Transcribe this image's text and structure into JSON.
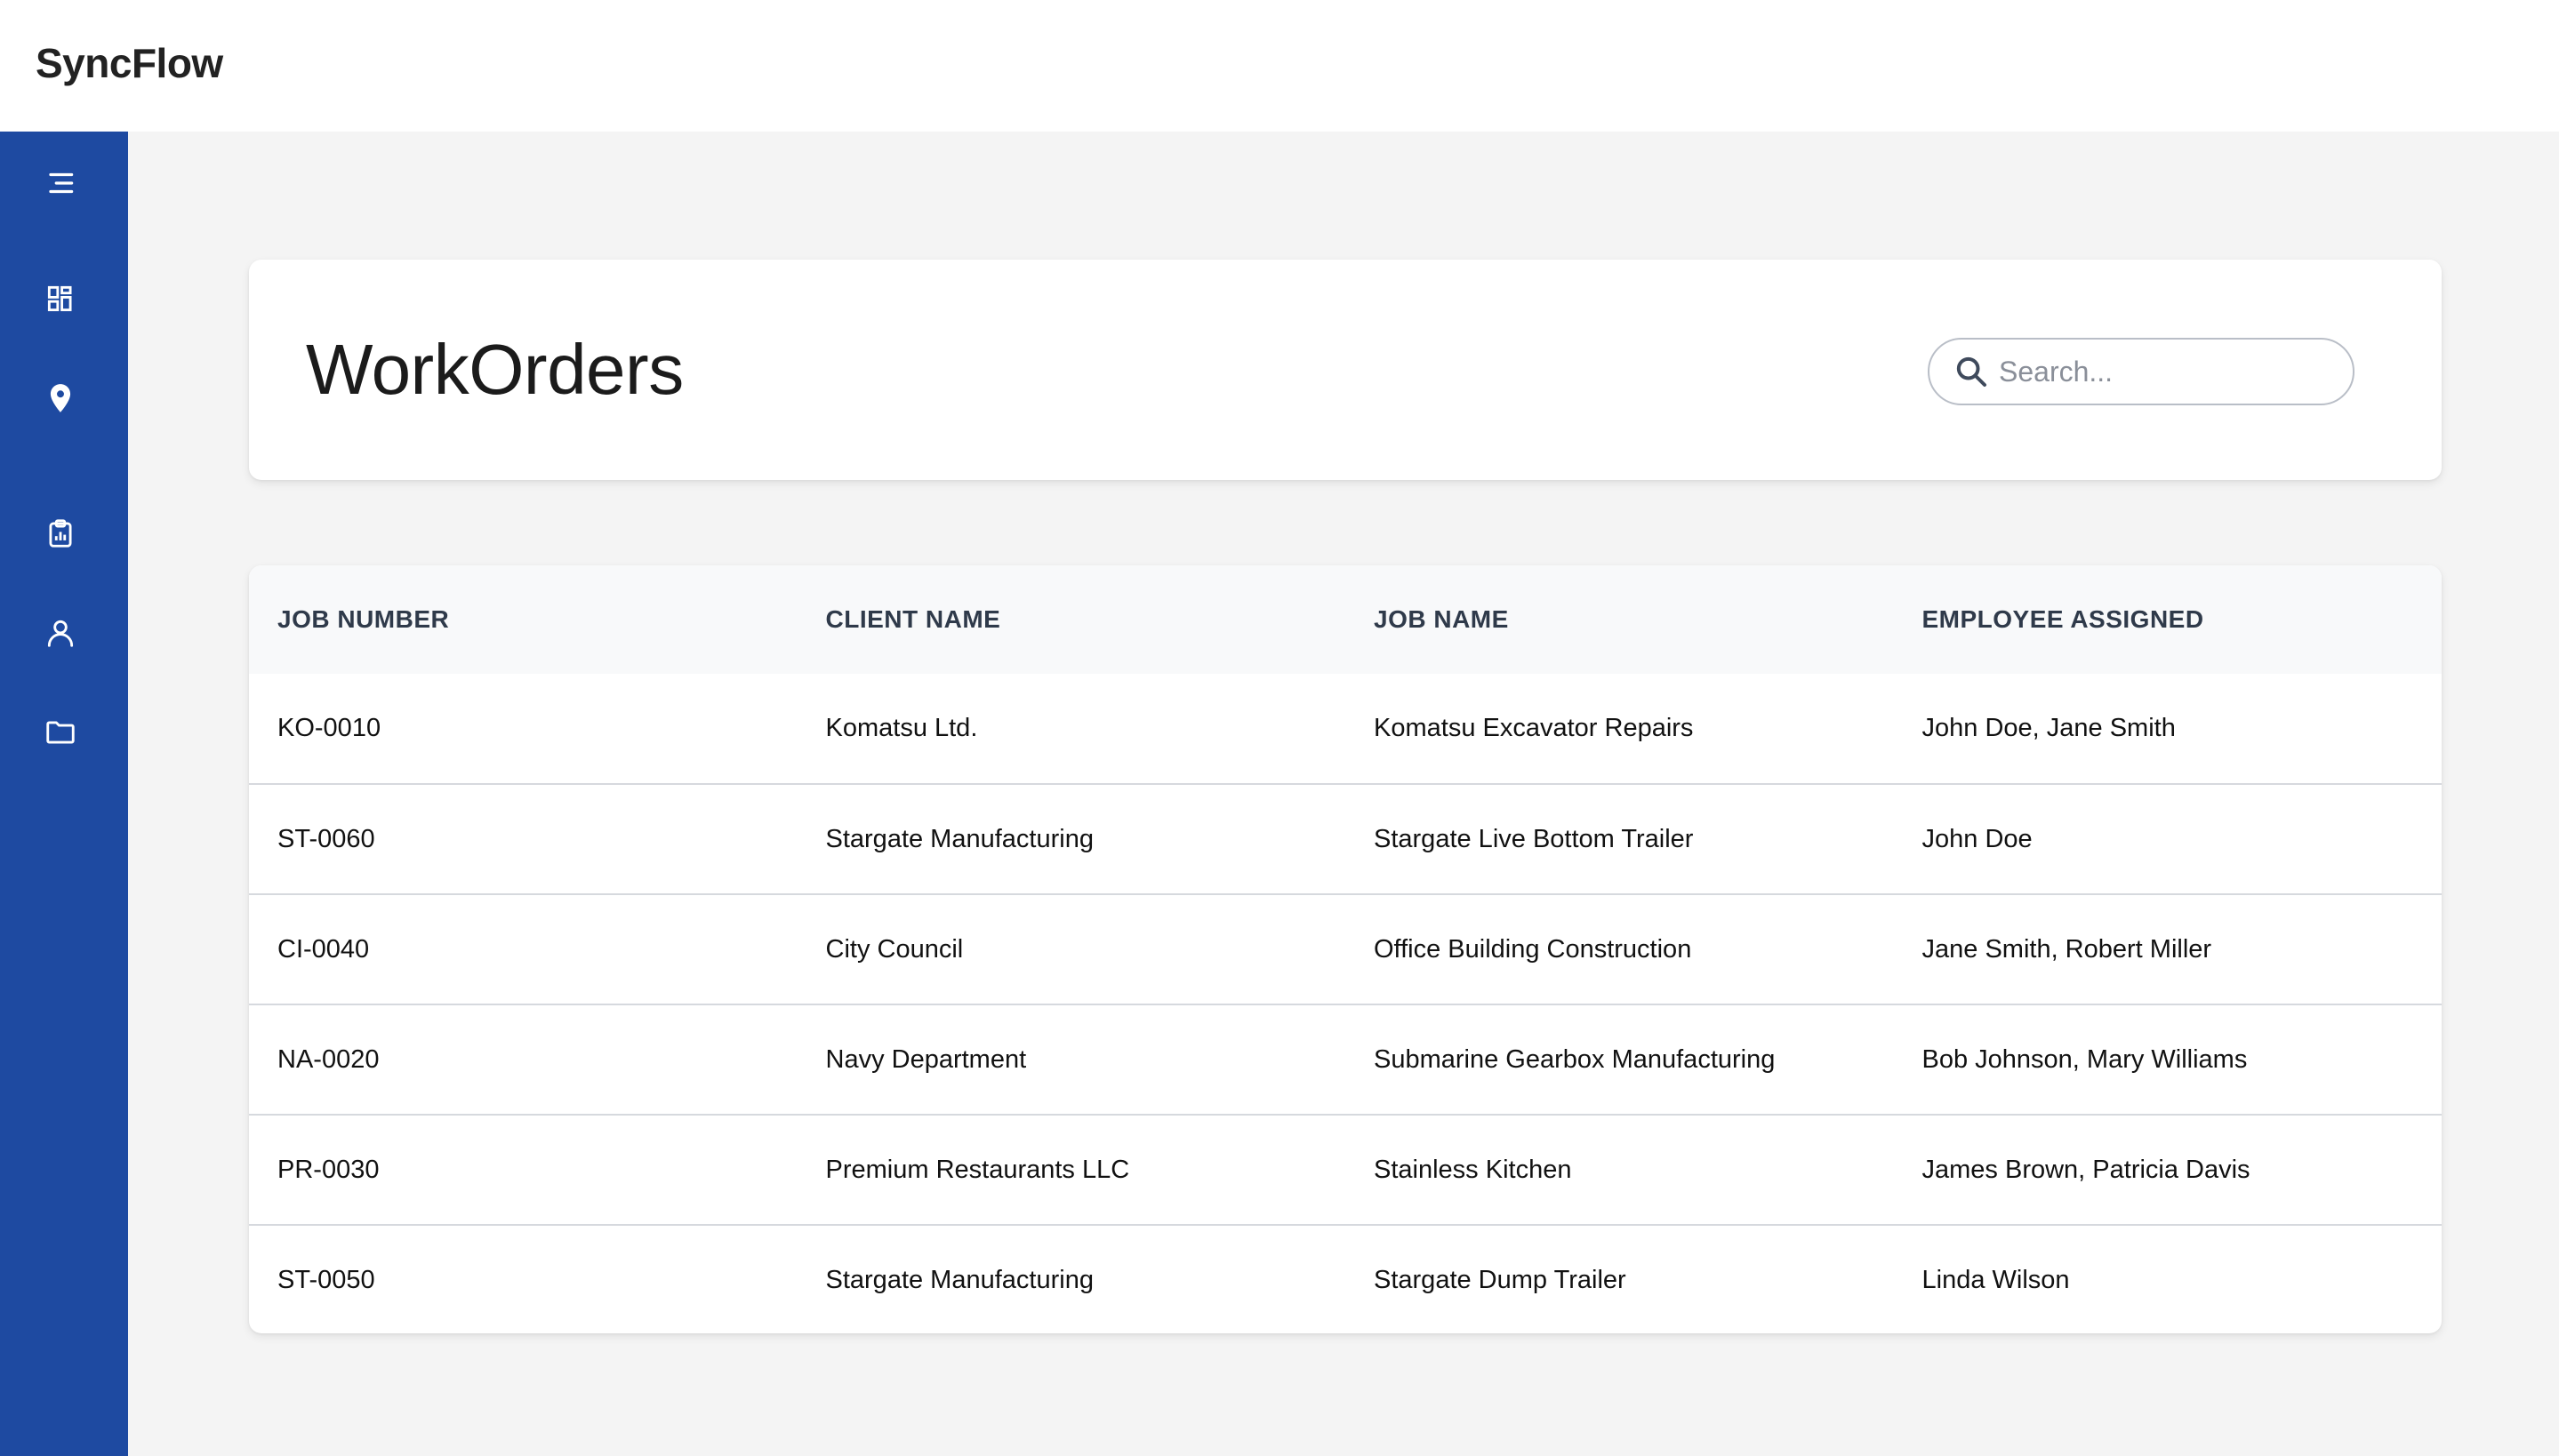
{
  "app": {
    "name": "SyncFlow"
  },
  "sidebar": {
    "items": [
      {
        "icon": "menu-icon"
      },
      {
        "icon": "dashboard-icon"
      },
      {
        "icon": "location-pin-icon"
      },
      {
        "icon": "clipboard-report-icon"
      },
      {
        "icon": "user-icon"
      },
      {
        "icon": "folder-icon"
      }
    ],
    "color": "#1e4aa1"
  },
  "page": {
    "title": "WorkOrders"
  },
  "search": {
    "placeholder": "Search..."
  },
  "table": {
    "headers": [
      "JOB NUMBER",
      "CLIENT NAME",
      "JOB NAME",
      "EMPLOYEE ASSIGNED"
    ],
    "rows": [
      [
        "KO-0010",
        "Komatsu Ltd.",
        "Komatsu Excavator Repairs",
        "John Doe, Jane Smith"
      ],
      [
        "ST-0060",
        "Stargate Manufacturing",
        "Stargate Live Bottom Trailer",
        "John Doe"
      ],
      [
        "CI-0040",
        "City Council",
        "Office Building Construction",
        "Jane Smith, Robert Miller"
      ],
      [
        "NA-0020",
        "Navy Department",
        "Submarine Gearbox Manufacturing",
        "Bob Johnson, Mary Williams"
      ],
      [
        "PR-0030",
        "Premium Restaurants LLC",
        "Stainless Kitchen",
        "James Brown, Patricia Davis"
      ],
      [
        "ST-0050",
        "Stargate Manufacturing",
        "Stargate Dump Trailer",
        "Linda Wilson"
      ]
    ]
  }
}
